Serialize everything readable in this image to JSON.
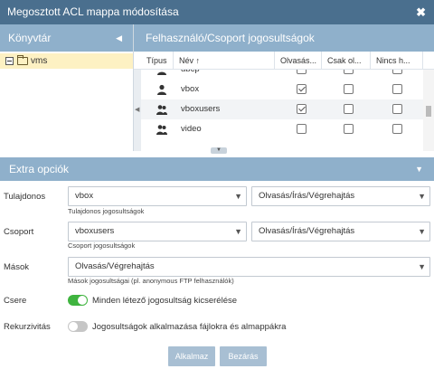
{
  "dialog": {
    "title": "Megosztott ACL mappa módosítása",
    "close_symbol": "✖"
  },
  "left_panel": {
    "title": "Könyvtár",
    "tree": [
      {
        "label": "vms",
        "selected": true
      }
    ]
  },
  "right_panel": {
    "title": "Felhasználó/Csoport jogosultságok",
    "columns": [
      "Típus",
      "Név",
      "Olvasás...",
      "Csak ol...",
      "Nincs h..."
    ],
    "sort_indicator": "↑",
    "rows": [
      {
        "type": "user",
        "name": "dbcp",
        "read": false,
        "readonly": false,
        "noaccess": false
      },
      {
        "type": "user",
        "name": "vbox",
        "read": true,
        "readonly": false,
        "noaccess": false
      },
      {
        "type": "group",
        "name": "vboxusers",
        "read": true,
        "readonly": false,
        "noaccess": false
      },
      {
        "type": "group",
        "name": "video",
        "read": false,
        "readonly": false,
        "noaccess": false
      }
    ]
  },
  "extra": {
    "title": "Extra opciók",
    "owner": {
      "label": "Tulajdonos",
      "value": "vbox",
      "perm": "Olvasás/Írás/Végrehajtás",
      "hint": "Tulajdonos jogosultságok"
    },
    "group": {
      "label": "Csoport",
      "value": "vboxusers",
      "perm": "Olvasás/Írás/Végrehajtás",
      "hint": "Csoport jogosultságok"
    },
    "others": {
      "label": "Mások",
      "perm": "Olvasás/Végrehajtás",
      "hint": "Mások jogosultságai (pl. anonymous FTP felhasználók)"
    },
    "replace": {
      "label": "Csere",
      "on": true,
      "text": "Minden létező jogosultság kicserélése"
    },
    "recursive": {
      "label": "Rekurzivitás",
      "on": false,
      "text": "Jogosultságok alkalmazása fájlokra és almappákra"
    }
  },
  "footer": {
    "apply": "Alkalmaz",
    "close": "Bezárás"
  },
  "colors": {
    "titlebar": "#4a6f8e",
    "panel_header": "#8fb0cb",
    "selected_tree": "#fdf1c3",
    "toggle_on": "#3fb43f",
    "button": "#a8bfd3"
  }
}
